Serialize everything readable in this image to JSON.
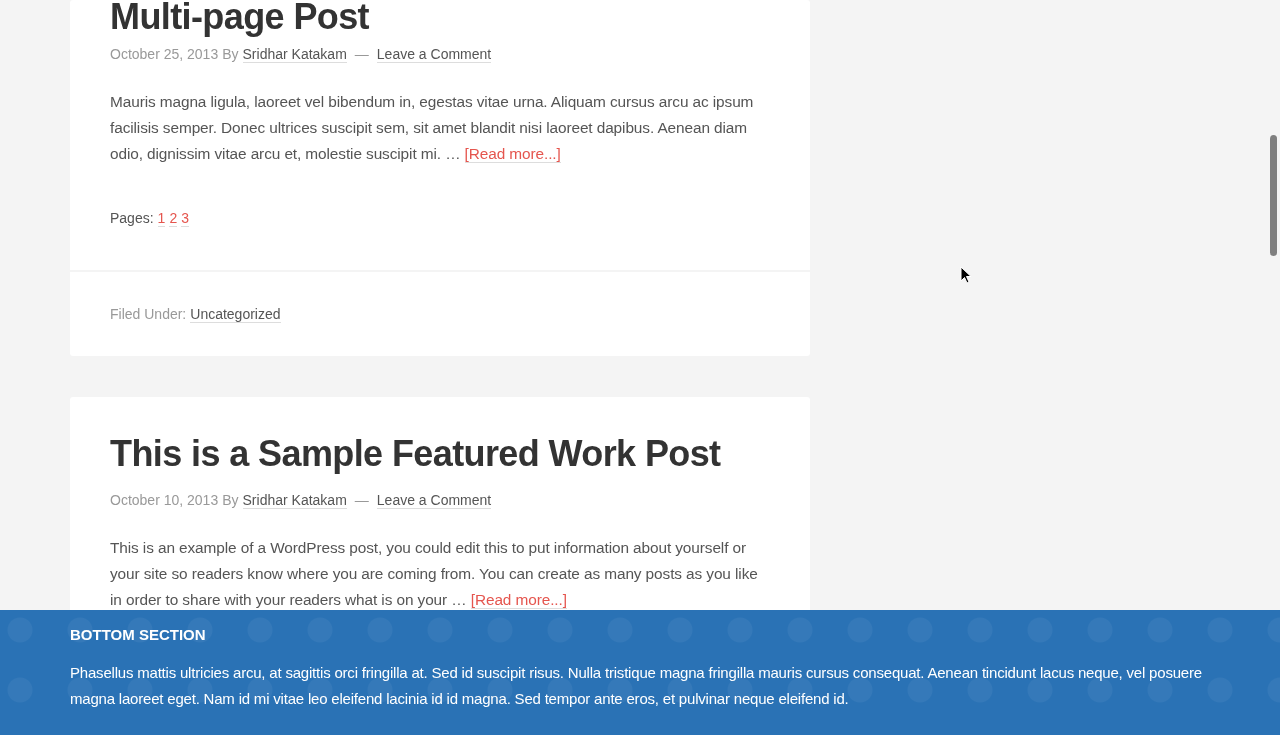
{
  "posts": [
    {
      "title": "Multi-page Post",
      "date": "October 25, 2013",
      "by": "By",
      "author": "Sridhar Katakam",
      "separator": "—",
      "comments": "Leave a Comment",
      "excerpt": "Mauris magna ligula, laoreet vel bibendum in, egestas vitae urna. Aliquam cursus arcu ac ipsum facilisis semper. Donec ultrices suscipit sem, sit amet blandit nisi laoreet dapibus. Aenean diam odio, dignissim vitae arcu et, molestie suscipit mi. …",
      "read_more": "[Read more...]",
      "pages": {
        "label": "Pages:",
        "links": [
          "1",
          "2",
          "3"
        ]
      },
      "footer": {
        "label": "Filed Under:",
        "category": "Uncategorized"
      }
    },
    {
      "title": "This is a Sample Featured Work Post",
      "date": "October 10, 2013",
      "by": "By",
      "author": "Sridhar Katakam",
      "separator": "—",
      "comments": "Leave a Comment",
      "excerpt": "This is an example of a WordPress post, you could edit this to put information about yourself or your site so readers know where you are coming from. You can create as many posts as you like in order to share with your readers what is on your …",
      "read_more": "[Read more...]"
    }
  ],
  "bottom_section": {
    "title": "BOTTOM SECTION",
    "text": "Phasellus mattis ultricies arcu, at sagittis orci fringilla at. Sed id suscipit risus. Nulla tristique magna fringilla mauris cursus consequat. Aenean tincidunt lacus neque, vel posuere magna laoreet eget. Nam id mi vitae leo eleifend lacinia id id magna. Sed tempor ante eros, et pulvinar neque eleifend id."
  }
}
